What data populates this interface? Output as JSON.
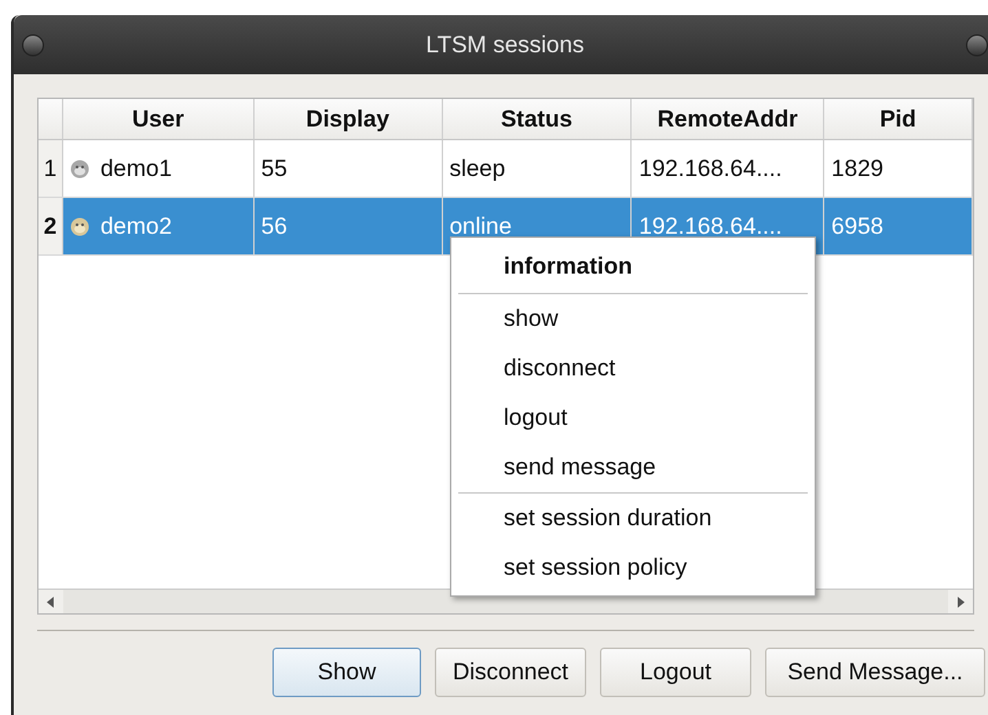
{
  "window": {
    "title": "LTSM sessions"
  },
  "table": {
    "columns": [
      "User",
      "Display",
      "Status",
      "RemoteAddr",
      "Pid"
    ],
    "rows": [
      {
        "number": "1",
        "selected": false,
        "cells": [
          "demo1",
          "55",
          "sleep",
          "192.168.64....",
          "1829"
        ]
      },
      {
        "number": "2",
        "selected": true,
        "cells": [
          "demo2",
          "56",
          "online",
          "192.168.64....",
          "6958"
        ]
      }
    ]
  },
  "context_menu": {
    "sections": [
      [
        {
          "label": "information",
          "kind": "header"
        }
      ],
      [
        {
          "label": "show",
          "kind": "action"
        },
        {
          "label": "disconnect",
          "kind": "action"
        },
        {
          "label": "logout",
          "kind": "action"
        },
        {
          "label": "send message",
          "kind": "action"
        }
      ],
      [
        {
          "label": "set session duration",
          "kind": "action"
        },
        {
          "label": "set session policy",
          "kind": "action"
        }
      ]
    ]
  },
  "buttons": [
    {
      "label": "Show",
      "focused": true
    },
    {
      "label": "Disconnect",
      "focused": false
    },
    {
      "label": "Logout",
      "focused": false
    },
    {
      "label": "Send Message...",
      "focused": false
    }
  ]
}
